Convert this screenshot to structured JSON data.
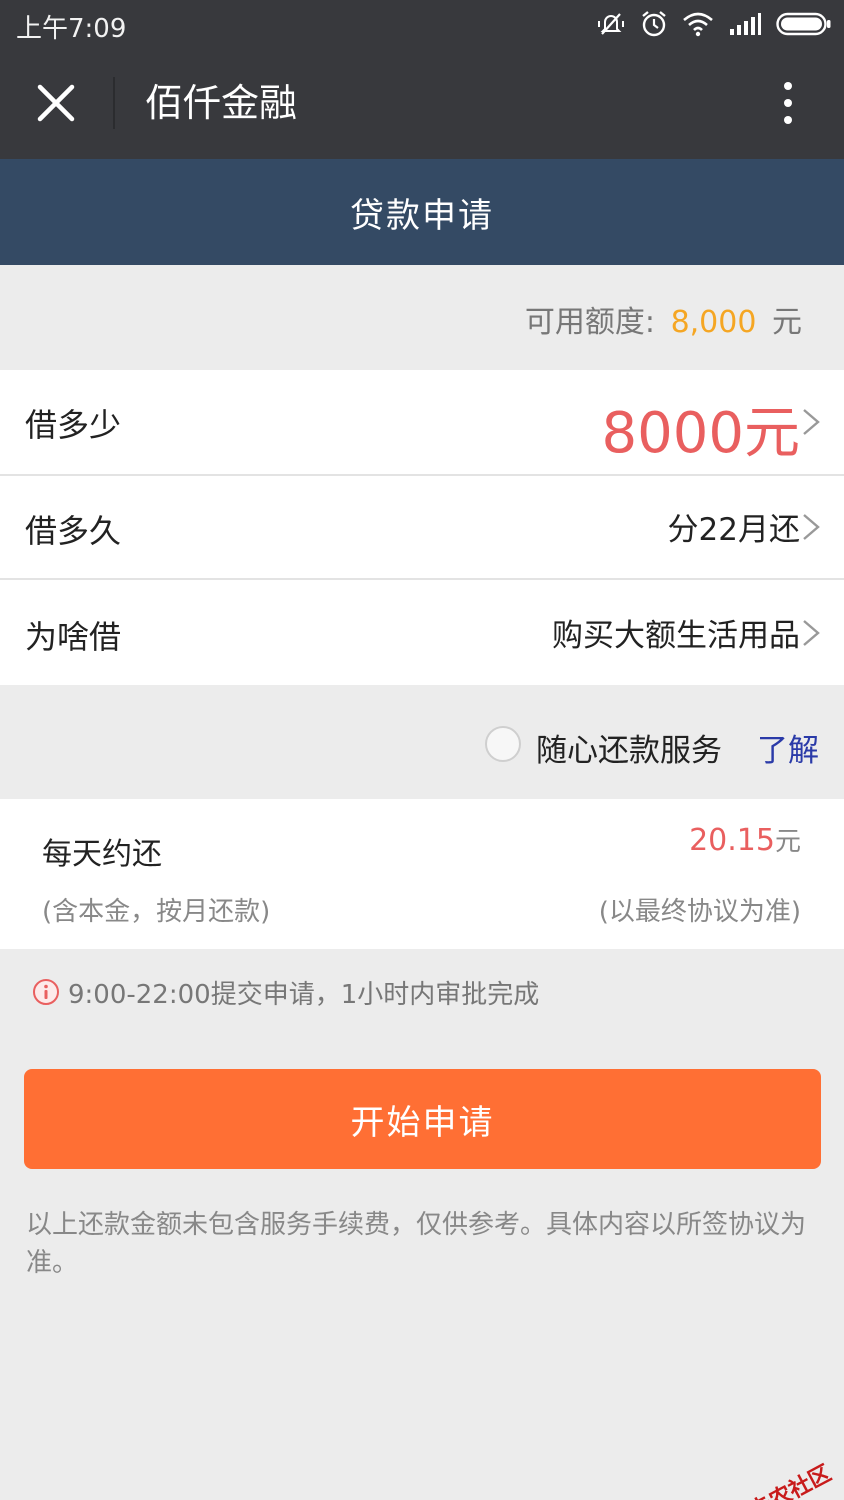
{
  "status_bar": {
    "time": "上午7:09"
  },
  "nav": {
    "title": "佰仟金融"
  },
  "page_header": {
    "title": "贷款申请"
  },
  "quota": {
    "label": "可用额度:",
    "amount": "8,000",
    "unit": "元"
  },
  "rows": [
    {
      "label": "借多少",
      "value": "8000元"
    },
    {
      "label": "借多久",
      "value": "分22月还"
    },
    {
      "label": "为啥借",
      "value": "购买大额生活用品"
    }
  ],
  "service": {
    "label": "随心还款服务",
    "link": "了解"
  },
  "daily": {
    "label": "每天约还",
    "amount": "20.15",
    "unit": "元",
    "note_left": "(含本金，按月还款)",
    "note_right": "(以最终协议为准)"
  },
  "info": {
    "text": "9:00-22:00提交申请，1小时内审批完成"
  },
  "submit": {
    "label": "开始申请"
  },
  "disclaimer": {
    "text": "以上还款金额未包含服务手续费，仅供参考。具体内容以所签协议为准。"
  },
  "watermark": {
    "text": "卡农社区"
  },
  "colors": {
    "nav_bg": "#38393d",
    "header_bg": "#344a64",
    "accent_orange": "#ff6f34",
    "amount_red": "#e95f5f",
    "quota_orange": "#f5a623",
    "link_blue": "#2a3aa8"
  }
}
